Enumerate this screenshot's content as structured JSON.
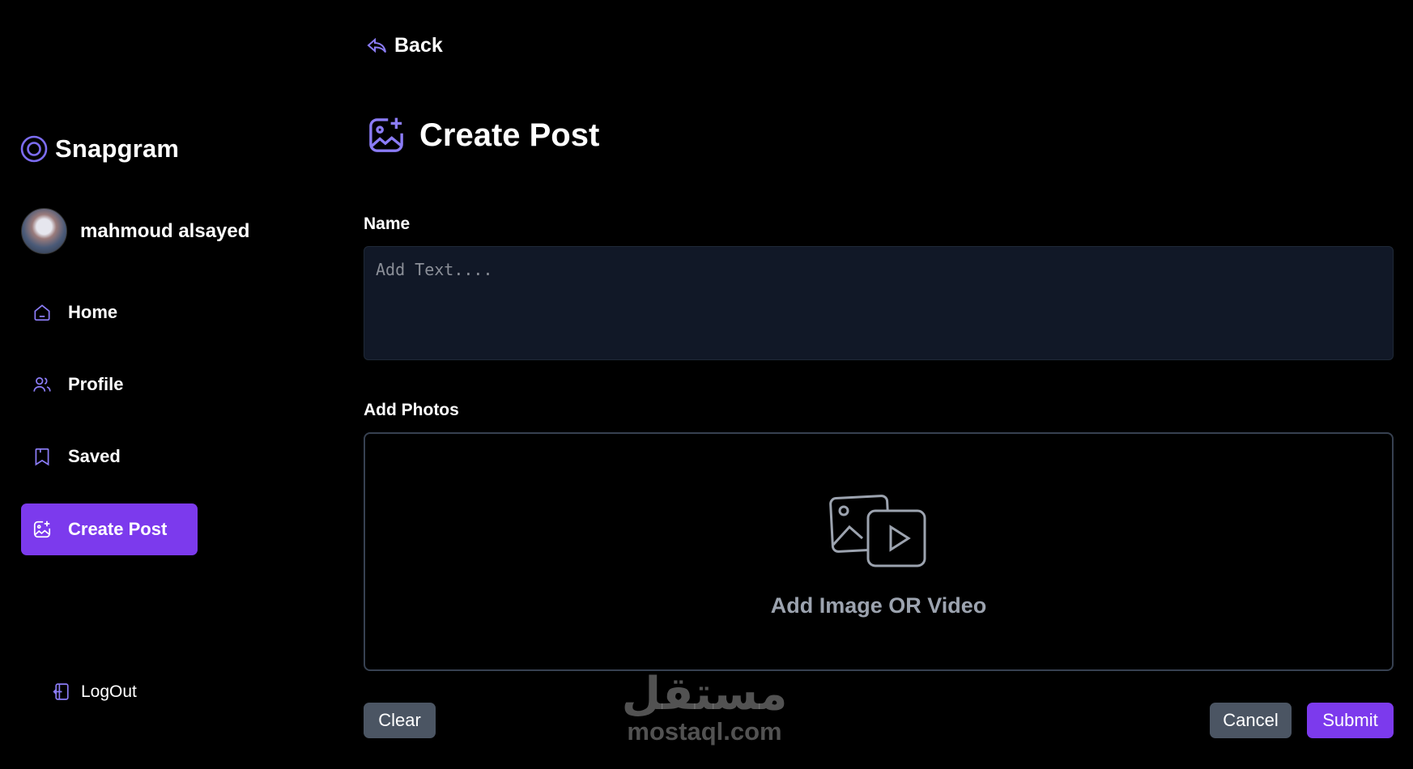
{
  "app": {
    "name": "Snapgram"
  },
  "user": {
    "name": "mahmoud alsayed"
  },
  "nav": {
    "items": [
      {
        "label": "Home",
        "icon": "home-icon"
      },
      {
        "label": "Profile",
        "icon": "users-icon"
      },
      {
        "label": "Saved",
        "icon": "bookmark-icon"
      },
      {
        "label": "Create Post",
        "icon": "gallery-add-icon",
        "active": true
      }
    ],
    "logout_label": "LogOut"
  },
  "header": {
    "back_label": "Back",
    "title": "Create Post"
  },
  "form": {
    "name_label": "Name",
    "name_placeholder": "Add Text....",
    "photos_label": "Add Photos",
    "dropzone_text": "Add Image OR Video"
  },
  "actions": {
    "clear": "Clear",
    "cancel": "Cancel",
    "submit": "Submit"
  },
  "watermark": {
    "arabic": "مستقل",
    "latin": "mostaql.com"
  },
  "colors": {
    "accent": "#7c3aed",
    "input_bg": "#111827",
    "button_gray": "#4b5563",
    "background": "#000000"
  }
}
